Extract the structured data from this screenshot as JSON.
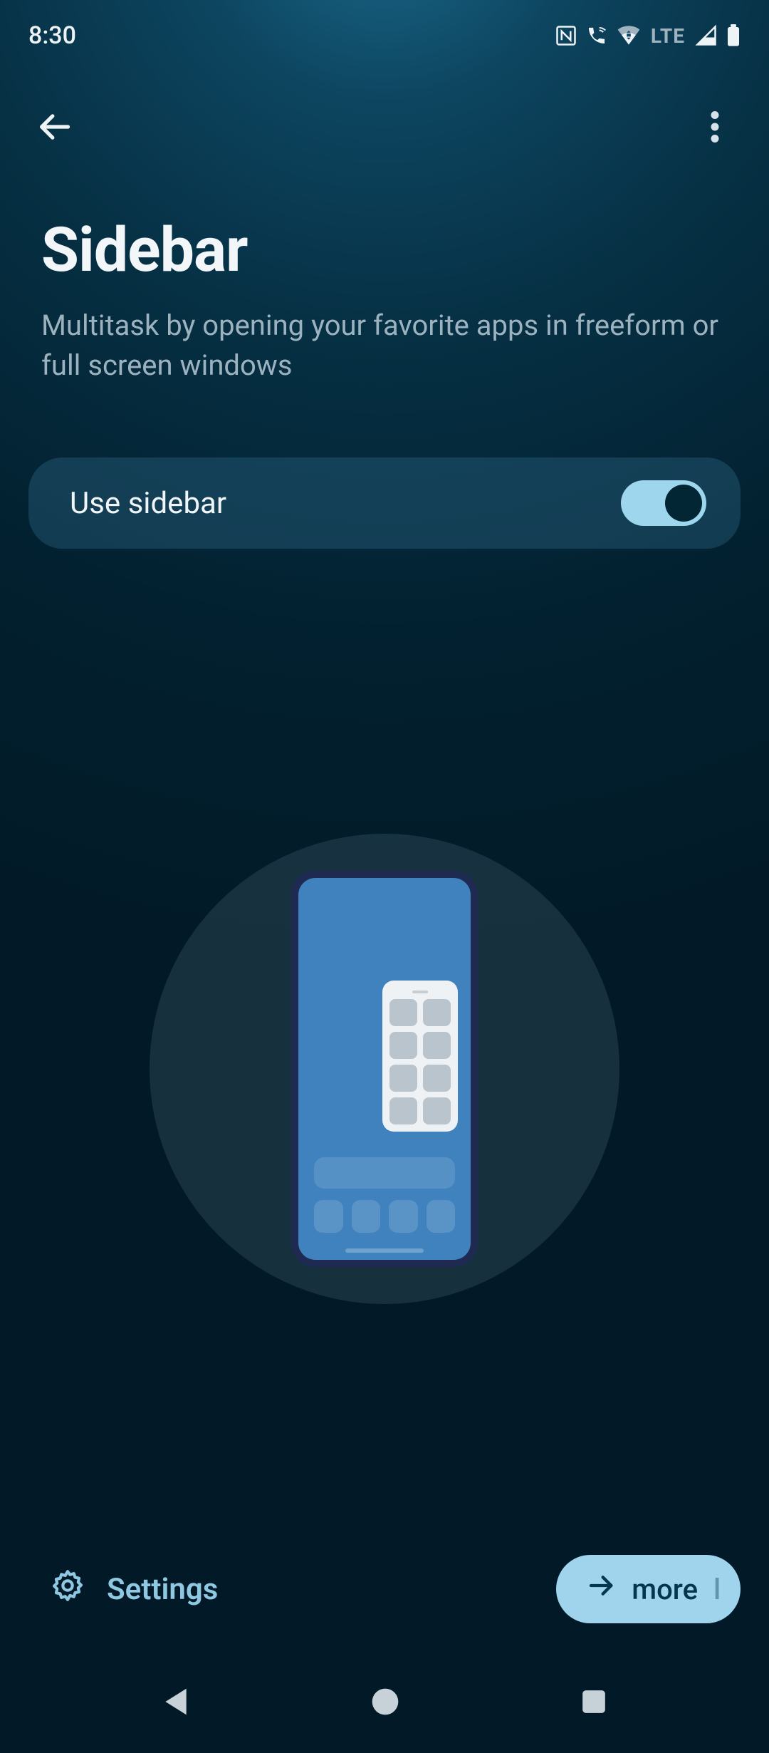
{
  "status": {
    "time": "8:30",
    "network_label": "LTE"
  },
  "header": {
    "title": "Sidebar",
    "subtitle": "Multitask by opening your favorite apps in freeform or full screen windows"
  },
  "toggle": {
    "label": "Use sidebar",
    "enabled": true
  },
  "footer": {
    "settings_label": "Settings",
    "more_label": "more"
  },
  "colors": {
    "accent": "#9fd4ec",
    "card_bg": "rgba(60,130,165,0.28)"
  }
}
